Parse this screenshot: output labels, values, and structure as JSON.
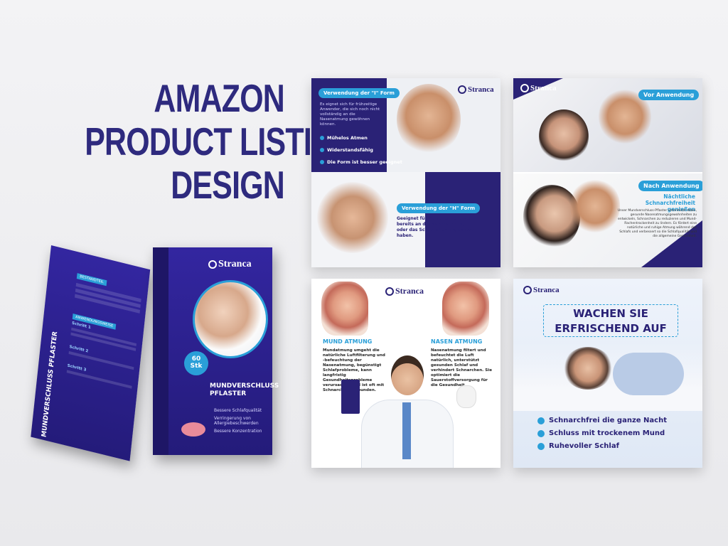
{
  "headline": [
    "AMAZON",
    "PRODUCT LISTING",
    "DESIGN"
  ],
  "brand": "Stranca",
  "colors": {
    "navy": "#2a2276",
    "accent": "#2a9fd8",
    "headline": "#2e2a7e"
  },
  "box": {
    "title": "MUNDVERSCHLUSS PFLASTER",
    "side_title": "MUNDVERSCHLUSS PFLASTER",
    "badge_count": "60",
    "badge_unit": "Stk",
    "features": [
      "Bessere Schlafqualität",
      "Verringerung von Allergiebeschwerden",
      "Bessere Konzentration"
    ],
    "back_heading_1": "BESTANDTEIL",
    "back_heading_2": "ANWENDUNGSWEISE",
    "back_step_1": "Schritt 1",
    "back_step_2": "Schritt 2",
    "back_step_3": "Schritt 3"
  },
  "panel1": {
    "pill_i": "Verwendung der \"I\" Form",
    "desc_i": "Es eignet sich für frühzeitige Anwender, die sich noch nicht vollständig an die Nasenatmung gewöhnen können.",
    "bullets": [
      "Mühelos Atmen",
      "Widerstandsfähig",
      "Die Form ist besser geeignet"
    ],
    "pill_h": "Verwendung der \"H\" Form",
    "desc_h": "Geeignet für Personen, die sich bereits an die Nasenatmung oder das Schnarchen angepasst haben."
  },
  "panel2": {
    "before": "Vor Anwendung",
    "after": "Nach Anwendung",
    "headline": "Nächtliche Schnarchfreiheit genießen",
    "body": "Unser Mundverschluss-Pflaster unterstützt dabei, gesunde Nasenatmungsgewohnheiten zu entwickeln, Schnarchen zu reduzieren und Mund-Rachentrockenheit zu lindern. Es fördert eine natürliche und ruhige Atmung während des Schlafs und verbessert so die Schlafqualität und die allgemeine Gesundheit."
  },
  "panel3": {
    "mouth_title": "MUND ATMUNG",
    "mouth_text": "Mundatmung umgeht die natürliche Luftfilterung und -befeuchtung der Nasenatmung, begünstigt Schlafprobleme, kann langfristig Gesundheitsprobleme verursachen und ist oft mit Schnarchen verbunden.",
    "nose_title": "NASEN ATMUNG",
    "nose_text": "Nasenatmung filtert und befeuchtet die Luft natürlich, unterstützt gesunden Schlaf und verhindert Schnarchen. Sie optimiert die Sauerstoffversorgung für die Gesundheit."
  },
  "panel4": {
    "headline_1": "WACHEN SIE",
    "headline_2": "ERFRISCHEND AUF",
    "benefits": [
      "Schnarchfrei die ganze Nacht",
      "Schluss mit trockenem Mund",
      "Ruhevoller Schlaf"
    ]
  }
}
